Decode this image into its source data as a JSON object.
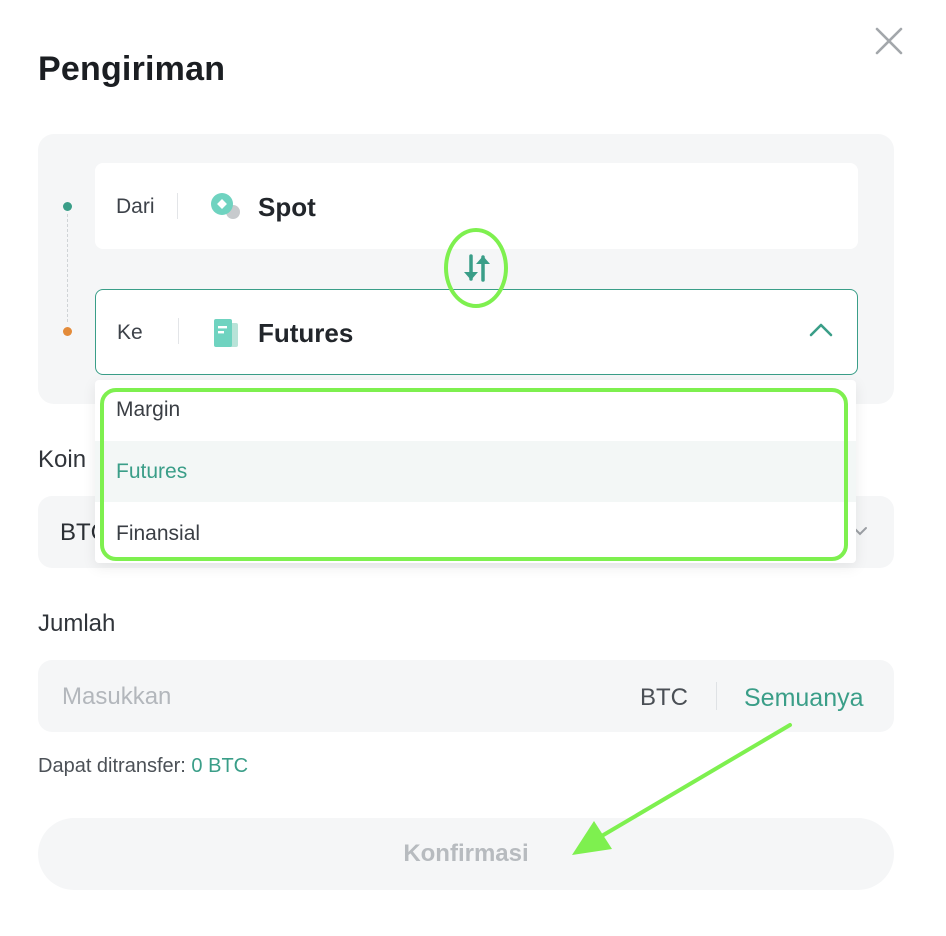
{
  "dialog": {
    "title": "Pengiriman"
  },
  "transfer": {
    "from": {
      "label": "Dari",
      "account": "Spot",
      "icon": "spot-coin-icon"
    },
    "to": {
      "label": "Ke",
      "account": "Futures",
      "icon": "futures-doc-icon",
      "dropdown_open": true
    },
    "swap_icon": "swap-arrows-icon"
  },
  "account_options": [
    {
      "label": "Margin",
      "selected": false
    },
    {
      "label": "Futures",
      "selected": true
    },
    {
      "label": "Finansial",
      "selected": false
    }
  ],
  "coin": {
    "label": "Koin",
    "value": "BTC"
  },
  "amount": {
    "label": "Jumlah",
    "placeholder": "Masukkan",
    "unit": "BTC",
    "all_label": "Semuanya"
  },
  "available": {
    "label": "Dapat ditransfer:",
    "value": "0 BTC"
  },
  "confirm": {
    "label": "Konfirmasi",
    "disabled": true
  },
  "colors": {
    "accent": "#3a9e88",
    "highlight_annotation": "#7ef04f",
    "to_dot": "#e38b3a"
  }
}
